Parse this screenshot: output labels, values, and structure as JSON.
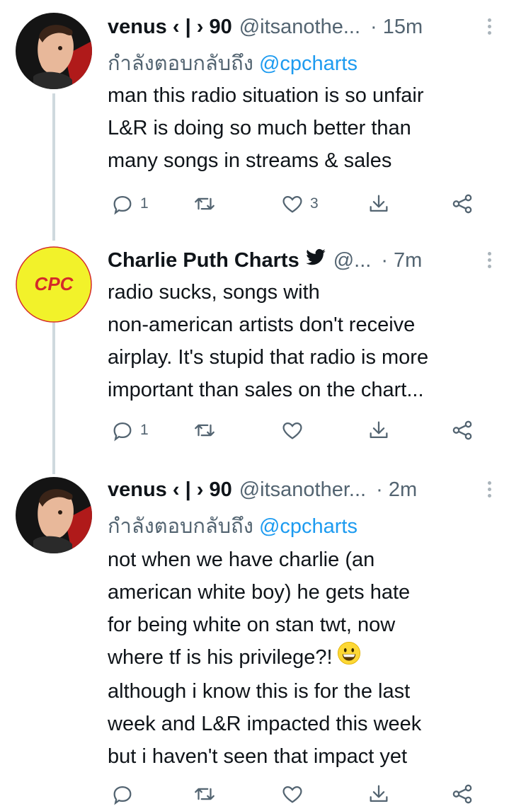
{
  "tweets": [
    {
      "name": "venus ‹ | › 90",
      "handle": "@itsanothe...",
      "time": "· 15m",
      "reply_prefix": "กำลังตอบกลับถึง",
      "reply_mention": "@cpcharts",
      "lines": [
        "man this radio situation is so unfair",
        "L&R is doing so much better than",
        "many songs in streams & sales"
      ],
      "reply_count": "1",
      "retweet_count": "",
      "like_count": "3"
    },
    {
      "name": "Charlie Puth Charts",
      "handle": "@...",
      "time": "· 7m",
      "avatar_text": "CPC",
      "lines": [
        "radio sucks, songs with",
        "non-american artists don't receive",
        "airplay. It's stupid that radio is more",
        "important than sales on the chart..."
      ],
      "reply_count": "1",
      "retweet_count": "",
      "like_count": ""
    },
    {
      "name": "venus ‹ | › 90",
      "handle": "@itsanother...",
      "time": "· 2m",
      "reply_prefix": "กำลังตอบกลับถึง",
      "reply_mention": "@cpcharts",
      "lines": [
        "not when we have charlie (an",
        "american white boy) he gets hate",
        "for being white on stan twt, now",
        "where tf is his privilege?!",
        "although i know this is for the last",
        "week and L&R impacted this week",
        "but i haven't seen that impact yet"
      ],
      "reply_count": "",
      "retweet_count": "",
      "like_count": ""
    }
  ],
  "colors": {
    "link": "#1d9bf0",
    "secondary": "#536471",
    "thread_line": "#cfd9de",
    "cpc_yellow": "#f2f22a",
    "cpc_red": "#d42a2a"
  },
  "icons": [
    "reply-icon",
    "retweet-icon",
    "like-icon",
    "share-icon",
    "connect-icon",
    "more-icon",
    "verified-bird-icon",
    "grinning-emoji"
  ]
}
